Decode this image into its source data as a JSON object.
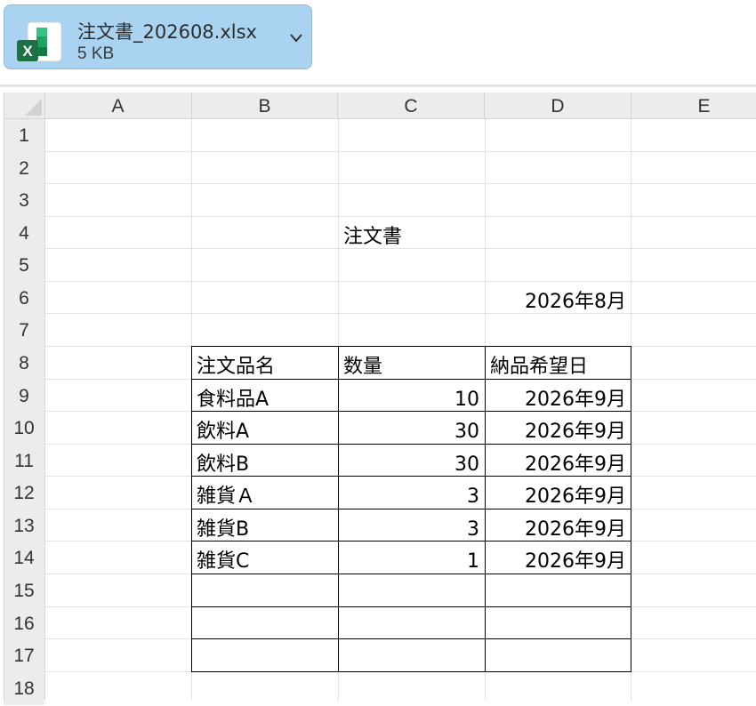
{
  "download": {
    "file_name": "注文書_202608.xlsx",
    "file_size": "5 KB",
    "icon": "excel-file-icon",
    "colors": {
      "chip_bg": "#a9d3f1",
      "excel_green": "#1e7145"
    }
  },
  "sheet": {
    "columns": [
      "A",
      "B",
      "C",
      "D",
      "E"
    ],
    "rows": [
      "1",
      "2",
      "3",
      "4",
      "5",
      "6",
      "7",
      "8",
      "9",
      "10",
      "11",
      "12",
      "13",
      "14",
      "15",
      "16",
      "17",
      "18"
    ],
    "title": "注文書",
    "order_month": "2026年8月",
    "table": {
      "headers": [
        "注文品名",
        "数量",
        "納品希望日"
      ],
      "rows": [
        {
          "item": "食料品A",
          "qty": "10",
          "date": "2026年9月"
        },
        {
          "item": "飲料A",
          "qty": "30",
          "date": "2026年9月"
        },
        {
          "item": "飲料B",
          "qty": "30",
          "date": "2026年9月"
        },
        {
          "item": "雑貨Ａ",
          "qty": "3",
          "date": "2026年9月"
        },
        {
          "item": "雑貨B",
          "qty": "3",
          "date": "2026年9月"
        },
        {
          "item": "雑貨C",
          "qty": "1",
          "date": "2026年9月"
        }
      ]
    }
  }
}
